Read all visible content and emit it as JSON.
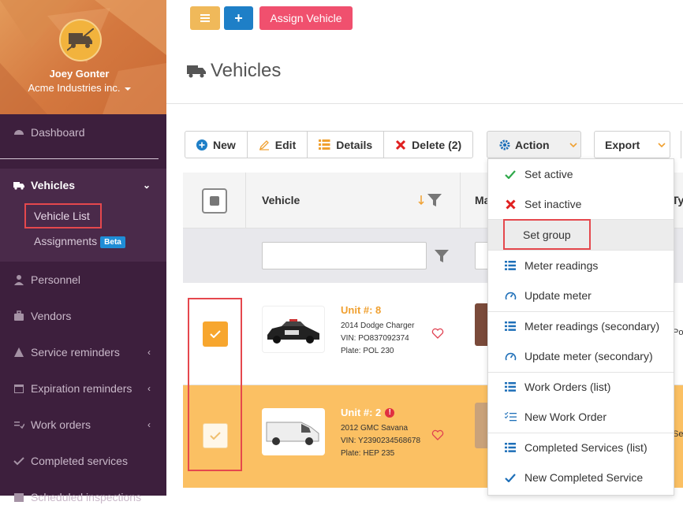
{
  "profile": {
    "name": "Joey Gonter",
    "company": "Acme Industries inc."
  },
  "nav": {
    "dashboard": "Dashboard",
    "vehicles": "Vehicles",
    "vehicle_list": "Vehicle List",
    "assignments": "Assignments",
    "beta": "Beta",
    "personnel": "Personnel",
    "vendors": "Vendors",
    "service_reminders": "Service reminders",
    "expiration_reminders": "Expiration reminders",
    "work_orders": "Work orders",
    "completed_services": "Completed services",
    "scheduled": "Scheduled inspections"
  },
  "top": {
    "assign_vehicle": "Assign Vehicle",
    "plus": "+"
  },
  "page": {
    "title": "Vehicles"
  },
  "toolbar": {
    "new": "New",
    "edit": "Edit",
    "details": "Details",
    "delete": "Delete (2)",
    "action": "Action",
    "export": "Export"
  },
  "table": {
    "col_vehicle": "Vehicle",
    "col_ma": "Ma",
    "col_ty": "Ty"
  },
  "rows": [
    {
      "unit": "Unit #: 8",
      "model": "2014 Dodge Charger",
      "vin": "VIN: PO837092374",
      "plate": "Plate: POL 230",
      "edge": "Po"
    },
    {
      "unit": "Unit #: 2",
      "model": "2012 GMC Savana",
      "vin": "VIN: Y2390234568678",
      "plate": "Plate: HEP 235",
      "edge": "Se"
    }
  ],
  "menu": {
    "set_active": "Set active",
    "set_inactive": "Set inactive",
    "set_group": "Set group",
    "meter_readings": "Meter readings",
    "update_meter": "Update meter",
    "meter_readings_sec": "Meter readings (secondary)",
    "update_meter_sec": "Update meter (secondary)",
    "work_orders_list": "Work Orders (list)",
    "new_work_order": "New Work Order",
    "completed_services_list": "Completed Services (list)",
    "new_completed_service": "New Completed Service"
  },
  "colors": {
    "sidebar": "#3d1f3d",
    "accent_orange": "#f0a030",
    "blue": "#1f8dd6",
    "pink": "#f0506e",
    "highlight": "#e5484d"
  }
}
